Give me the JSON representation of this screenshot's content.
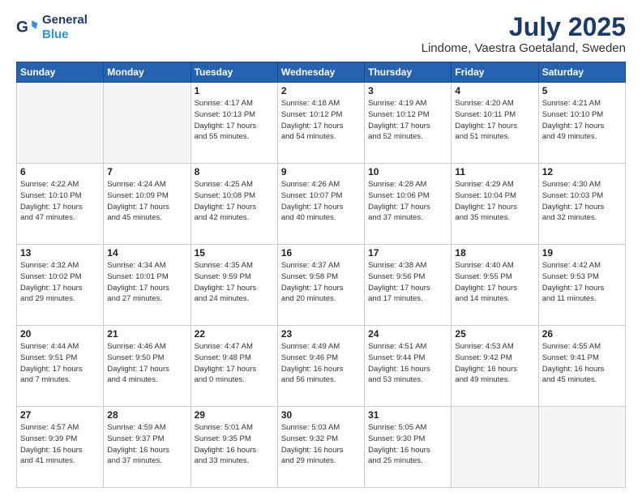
{
  "header": {
    "logo_line1": "General",
    "logo_line2": "Blue",
    "main_title": "July 2025",
    "subtitle": "Lindome, Vaestra Goetaland, Sweden"
  },
  "weekdays": [
    "Sunday",
    "Monday",
    "Tuesday",
    "Wednesday",
    "Thursday",
    "Friday",
    "Saturday"
  ],
  "weeks": [
    [
      {
        "day": "",
        "info": ""
      },
      {
        "day": "",
        "info": ""
      },
      {
        "day": "1",
        "info": "Sunrise: 4:17 AM\nSunset: 10:13 PM\nDaylight: 17 hours\nand 55 minutes."
      },
      {
        "day": "2",
        "info": "Sunrise: 4:18 AM\nSunset: 10:12 PM\nDaylight: 17 hours\nand 54 minutes."
      },
      {
        "day": "3",
        "info": "Sunrise: 4:19 AM\nSunset: 10:12 PM\nDaylight: 17 hours\nand 52 minutes."
      },
      {
        "day": "4",
        "info": "Sunrise: 4:20 AM\nSunset: 10:11 PM\nDaylight: 17 hours\nand 51 minutes."
      },
      {
        "day": "5",
        "info": "Sunrise: 4:21 AM\nSunset: 10:10 PM\nDaylight: 17 hours\nand 49 minutes."
      }
    ],
    [
      {
        "day": "6",
        "info": "Sunrise: 4:22 AM\nSunset: 10:10 PM\nDaylight: 17 hours\nand 47 minutes."
      },
      {
        "day": "7",
        "info": "Sunrise: 4:24 AM\nSunset: 10:09 PM\nDaylight: 17 hours\nand 45 minutes."
      },
      {
        "day": "8",
        "info": "Sunrise: 4:25 AM\nSunset: 10:08 PM\nDaylight: 17 hours\nand 42 minutes."
      },
      {
        "day": "9",
        "info": "Sunrise: 4:26 AM\nSunset: 10:07 PM\nDaylight: 17 hours\nand 40 minutes."
      },
      {
        "day": "10",
        "info": "Sunrise: 4:28 AM\nSunset: 10:06 PM\nDaylight: 17 hours\nand 37 minutes."
      },
      {
        "day": "11",
        "info": "Sunrise: 4:29 AM\nSunset: 10:04 PM\nDaylight: 17 hours\nand 35 minutes."
      },
      {
        "day": "12",
        "info": "Sunrise: 4:30 AM\nSunset: 10:03 PM\nDaylight: 17 hours\nand 32 minutes."
      }
    ],
    [
      {
        "day": "13",
        "info": "Sunrise: 4:32 AM\nSunset: 10:02 PM\nDaylight: 17 hours\nand 29 minutes."
      },
      {
        "day": "14",
        "info": "Sunrise: 4:34 AM\nSunset: 10:01 PM\nDaylight: 17 hours\nand 27 minutes."
      },
      {
        "day": "15",
        "info": "Sunrise: 4:35 AM\nSunset: 9:59 PM\nDaylight: 17 hours\nand 24 minutes."
      },
      {
        "day": "16",
        "info": "Sunrise: 4:37 AM\nSunset: 9:58 PM\nDaylight: 17 hours\nand 20 minutes."
      },
      {
        "day": "17",
        "info": "Sunrise: 4:38 AM\nSunset: 9:56 PM\nDaylight: 17 hours\nand 17 minutes."
      },
      {
        "day": "18",
        "info": "Sunrise: 4:40 AM\nSunset: 9:55 PM\nDaylight: 17 hours\nand 14 minutes."
      },
      {
        "day": "19",
        "info": "Sunrise: 4:42 AM\nSunset: 9:53 PM\nDaylight: 17 hours\nand 11 minutes."
      }
    ],
    [
      {
        "day": "20",
        "info": "Sunrise: 4:44 AM\nSunset: 9:51 PM\nDaylight: 17 hours\nand 7 minutes."
      },
      {
        "day": "21",
        "info": "Sunrise: 4:46 AM\nSunset: 9:50 PM\nDaylight: 17 hours\nand 4 minutes."
      },
      {
        "day": "22",
        "info": "Sunrise: 4:47 AM\nSunset: 9:48 PM\nDaylight: 17 hours\nand 0 minutes."
      },
      {
        "day": "23",
        "info": "Sunrise: 4:49 AM\nSunset: 9:46 PM\nDaylight: 16 hours\nand 56 minutes."
      },
      {
        "day": "24",
        "info": "Sunrise: 4:51 AM\nSunset: 9:44 PM\nDaylight: 16 hours\nand 53 minutes."
      },
      {
        "day": "25",
        "info": "Sunrise: 4:53 AM\nSunset: 9:42 PM\nDaylight: 16 hours\nand 49 minutes."
      },
      {
        "day": "26",
        "info": "Sunrise: 4:55 AM\nSunset: 9:41 PM\nDaylight: 16 hours\nand 45 minutes."
      }
    ],
    [
      {
        "day": "27",
        "info": "Sunrise: 4:57 AM\nSunset: 9:39 PM\nDaylight: 16 hours\nand 41 minutes."
      },
      {
        "day": "28",
        "info": "Sunrise: 4:59 AM\nSunset: 9:37 PM\nDaylight: 16 hours\nand 37 minutes."
      },
      {
        "day": "29",
        "info": "Sunrise: 5:01 AM\nSunset: 9:35 PM\nDaylight: 16 hours\nand 33 minutes."
      },
      {
        "day": "30",
        "info": "Sunrise: 5:03 AM\nSunset: 9:32 PM\nDaylight: 16 hours\nand 29 minutes."
      },
      {
        "day": "31",
        "info": "Sunrise: 5:05 AM\nSunset: 9:30 PM\nDaylight: 16 hours\nand 25 minutes."
      },
      {
        "day": "",
        "info": ""
      },
      {
        "day": "",
        "info": ""
      }
    ]
  ]
}
